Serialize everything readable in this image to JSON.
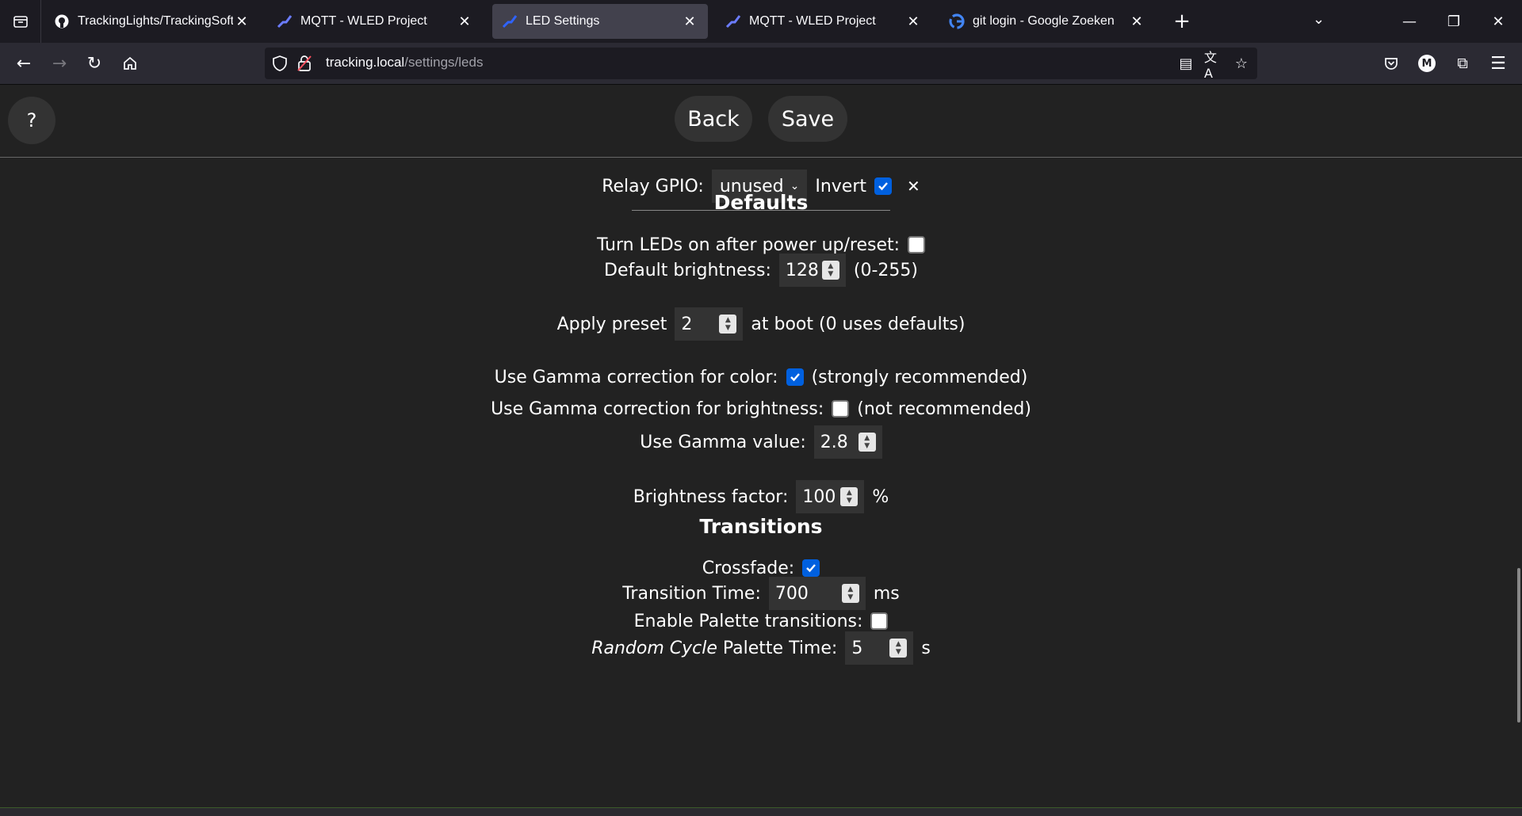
{
  "browser": {
    "tabs": [
      {
        "title": "TrackingLights/TrackingSoftware",
        "favicon": "github-icon",
        "active": false
      },
      {
        "title": "MQTT - WLED Project",
        "favicon": "wled-icon",
        "active": false
      },
      {
        "title": "LED Settings",
        "favicon": "wled-icon",
        "active": true
      },
      {
        "title": "MQTT - WLED Project",
        "favicon": "wled-icon",
        "active": false
      },
      {
        "title": "git login - Google Zoeken",
        "favicon": "google-icon",
        "active": false
      }
    ],
    "url": {
      "host": "tracking.local",
      "path": "/settings/leds"
    }
  },
  "page": {
    "help_label": "?",
    "back_label": "Back",
    "save_label": "Save",
    "relay": {
      "label": "Relay GPIO:",
      "value": "unused",
      "invert_label": "Invert",
      "invert_checked": true
    },
    "defaults": {
      "heading": "Defaults",
      "turn_on_label": "Turn LEDs on after power up/reset:",
      "turn_on_checked": false,
      "brightness_label": "Default brightness:",
      "brightness_value": "128",
      "brightness_range": "(0-255)",
      "preset_label": "Apply preset",
      "preset_value": "2",
      "preset_suffix": "at boot (0 uses defaults)",
      "gamma_color_label": "Use Gamma correction for color:",
      "gamma_color_checked": true,
      "gamma_color_note": "(strongly recommended)",
      "gamma_bri_label": "Use Gamma correction for brightness:",
      "gamma_bri_checked": false,
      "gamma_bri_note": "(not recommended)",
      "gamma_value_label": "Use Gamma value:",
      "gamma_value": "2.8",
      "bri_factor_label": "Brightness factor:",
      "bri_factor_value": "100",
      "bri_factor_unit": "%"
    },
    "transitions": {
      "heading": "Transitions",
      "crossfade_label": "Crossfade:",
      "crossfade_checked": true,
      "time_label": "Transition Time:",
      "time_value": "700",
      "time_unit": "ms",
      "palette_label": "Enable Palette transitions:",
      "palette_checked": false,
      "random_cycle_italic": "Random Cycle",
      "random_cycle_label": "Palette Time:",
      "random_cycle_value": "5",
      "random_cycle_unit": "s"
    }
  }
}
